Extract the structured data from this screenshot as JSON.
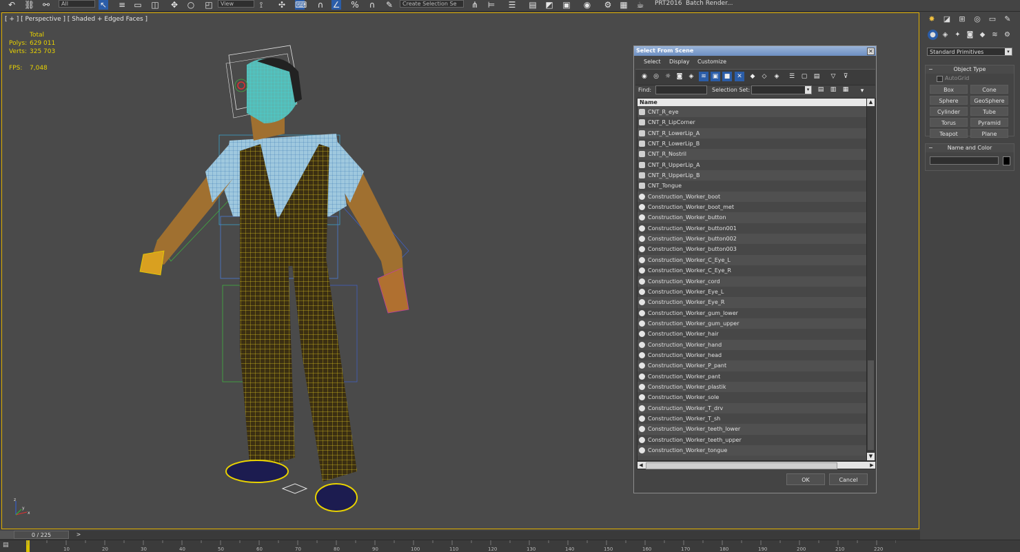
{
  "toolbar": {
    "filter_dropdown": "All",
    "refcoord_dropdown": "View",
    "selection_set_field": "Create Selection Se",
    "text_prt": "PRT2016",
    "text_batch": "Batch Render..."
  },
  "viewport": {
    "label": "[ + ] [ Perspective ] [ Shaded + Edged Faces ]",
    "stats": {
      "total_label": "Total",
      "polys_label": "Polys:",
      "polys_value": "629 011",
      "verts_label": "Verts:",
      "verts_value": "325 703",
      "fps_label": "FPS:",
      "fps_value": "7,048"
    },
    "axis": {
      "x": "x",
      "y": "y",
      "z": "z"
    }
  },
  "command_panel": {
    "dropdown": "Standard Primitives",
    "object_type": {
      "title": "Object Type",
      "autogrid": "AutoGrid",
      "buttons": [
        "Box",
        "Cone",
        "Sphere",
        "GeoSphere",
        "Cylinder",
        "Tube",
        "Torus",
        "Pyramid",
        "Teapot",
        "Plane"
      ]
    },
    "name_color": {
      "title": "Name and Color"
    }
  },
  "dialog": {
    "title": "Select From Scene",
    "menu": [
      "Select",
      "Display",
      "Customize"
    ],
    "find_label": "Find:",
    "selection_set_label": "Selection Set:",
    "column_name": "Name",
    "items": [
      {
        "name": "CNT_R_eye",
        "type": "helper"
      },
      {
        "name": "CNT_R_LipCorner",
        "type": "helper"
      },
      {
        "name": "CNT_R_LowerLip_A",
        "type": "helper"
      },
      {
        "name": "CNT_R_LowerLip_B",
        "type": "helper"
      },
      {
        "name": "CNT_R_Nostril",
        "type": "helper"
      },
      {
        "name": "CNT_R_UpperLip_A",
        "type": "helper"
      },
      {
        "name": "CNT_R_UpperLip_B",
        "type": "helper"
      },
      {
        "name": "CNT_Tongue",
        "type": "helper"
      },
      {
        "name": "Construction_Worker_boot",
        "type": "geometry"
      },
      {
        "name": "Construction_Worker_boot_met",
        "type": "geometry"
      },
      {
        "name": "Construction_Worker_button",
        "type": "geometry"
      },
      {
        "name": "Construction_Worker_button001",
        "type": "geometry"
      },
      {
        "name": "Construction_Worker_button002",
        "type": "geometry"
      },
      {
        "name": "Construction_Worker_button003",
        "type": "geometry"
      },
      {
        "name": "Construction_Worker_C_Eye_L",
        "type": "geometry"
      },
      {
        "name": "Construction_Worker_C_Eye_R",
        "type": "geometry"
      },
      {
        "name": "Construction_Worker_cord",
        "type": "geometry"
      },
      {
        "name": "Construction_Worker_Eye_L",
        "type": "geometry"
      },
      {
        "name": "Construction_Worker_Eye_R",
        "type": "geometry"
      },
      {
        "name": "Construction_Worker_gum_lower",
        "type": "geometry"
      },
      {
        "name": "Construction_Worker_gum_upper",
        "type": "geometry"
      },
      {
        "name": "Construction_Worker_hair",
        "type": "geometry"
      },
      {
        "name": "Construction_Worker_hand",
        "type": "geometry"
      },
      {
        "name": "Construction_Worker_head",
        "type": "geometry"
      },
      {
        "name": "Construction_Worker_P_pant",
        "type": "geometry"
      },
      {
        "name": "Construction_Worker_pant",
        "type": "geometry"
      },
      {
        "name": "Construction_Worker_plastik",
        "type": "geometry"
      },
      {
        "name": "Construction_Worker_sole",
        "type": "geometry"
      },
      {
        "name": "Construction_Worker_T_drv",
        "type": "geometry"
      },
      {
        "name": "Construction_Worker_T_sh",
        "type": "geometry"
      },
      {
        "name": "Construction_Worker_teeth_lower",
        "type": "geometry"
      },
      {
        "name": "Construction_Worker_teeth_upper",
        "type": "geometry"
      },
      {
        "name": "Construction_Worker_tongue",
        "type": "geometry"
      }
    ],
    "ok_label": "OK",
    "cancel_label": "Cancel"
  },
  "timeline": {
    "frame_display": "0 / 225",
    "next_label": ">",
    "tick_labels": [
      "10",
      "20",
      "30",
      "40",
      "50",
      "60",
      "70",
      "80",
      "90",
      "100",
      "110",
      "120",
      "130",
      "140",
      "150",
      "160",
      "170",
      "180",
      "190",
      "200",
      "210",
      "220"
    ]
  },
  "colors": {
    "viewport_border": "#e0b000",
    "stats_text": "#e8d200",
    "mesh_yellow": "#d9c020",
    "mesh_cyan": "#40e0e0",
    "active_blue": "#2b5da8"
  }
}
